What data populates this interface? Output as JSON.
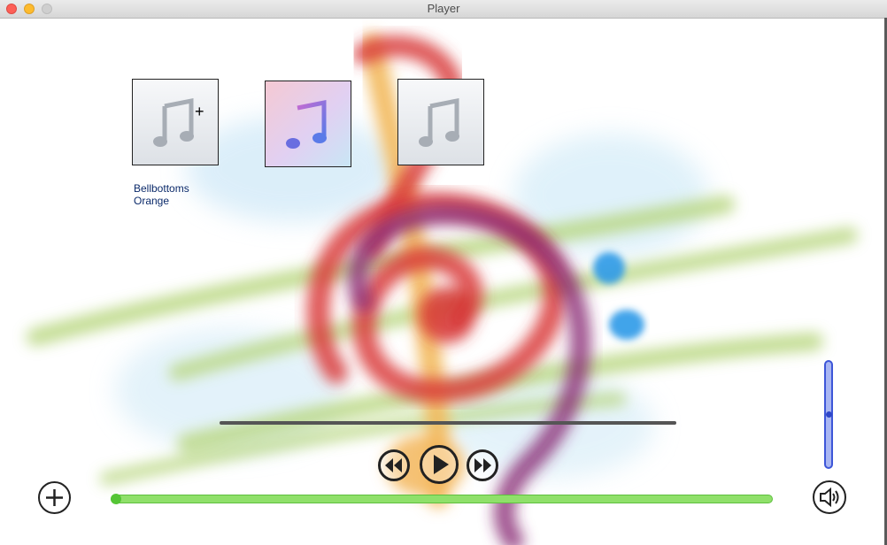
{
  "window": {
    "title": "Player"
  },
  "library": {
    "items": [
      {
        "name": "album-tile-1",
        "title": "Bellbottoms",
        "artist": "Orange"
      },
      {
        "name": "album-tile-2"
      },
      {
        "name": "album-tile-3"
      }
    ]
  },
  "playback": {
    "progress_fraction": 0.0,
    "volume_fraction": 0.5
  },
  "icons": {
    "add": "plus-icon",
    "rewind": "rewind-icon",
    "play": "play-icon",
    "fast_forward": "fast-forward-icon",
    "volume": "speaker-icon",
    "tile": "music-note-icon"
  },
  "colors": {
    "progress": "#8fe06a",
    "volume": "#a9b6f2",
    "label": "#0b2a6a"
  }
}
